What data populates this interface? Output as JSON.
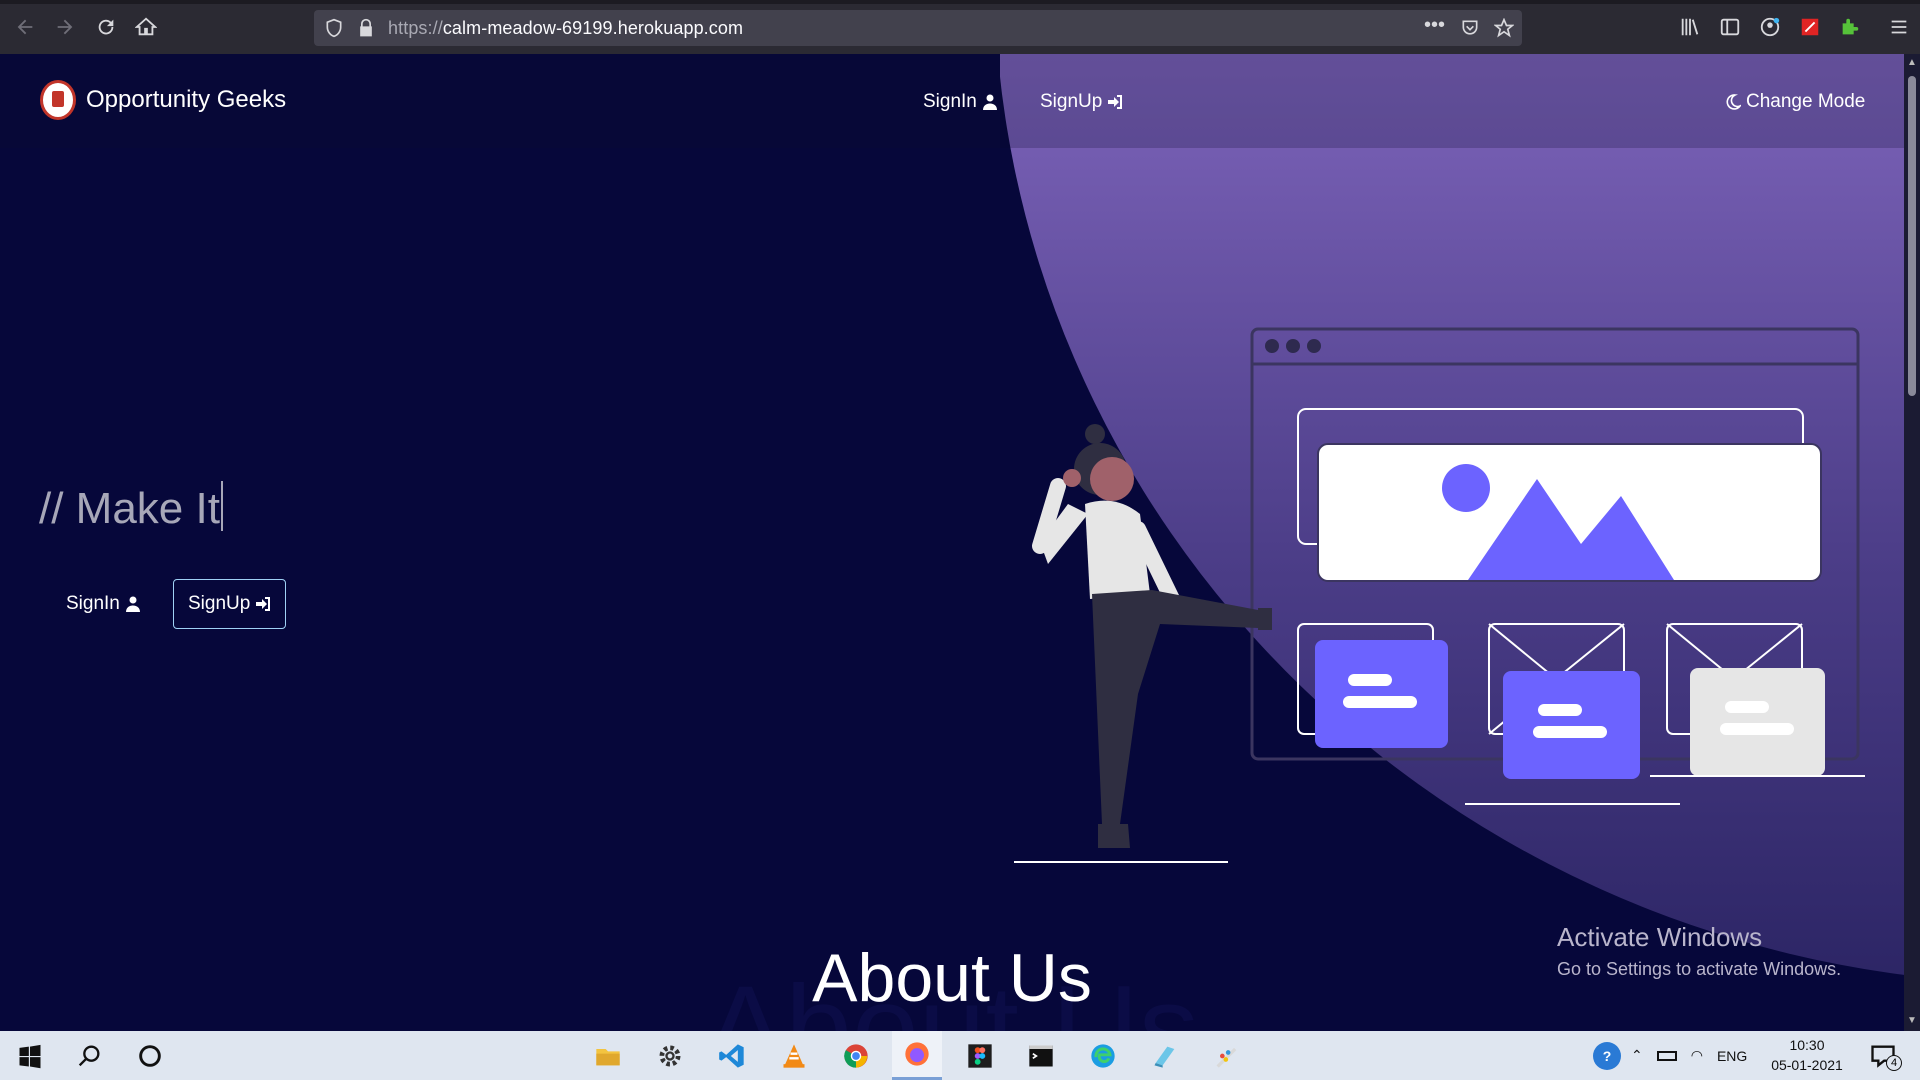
{
  "browser": {
    "url_scheme": "https://",
    "url_host": "calm-meadow-69199.herokuapp.com",
    "icons": [
      "back-icon",
      "forward-icon",
      "reload-icon",
      "home-icon",
      "shield-icon",
      "lock-icon",
      "more-icon",
      "pocket-icon",
      "star-icon",
      "library-icon",
      "sidebar-icon",
      "account-icon",
      "extension-red-icon",
      "puzzle-icon",
      "menu-icon"
    ]
  },
  "site": {
    "brand": "Opportunity Geeks",
    "nav": {
      "signin": "SignIn",
      "signup": "SignUp",
      "change_mode": "Change Mode"
    },
    "hero": {
      "typed_text": "// Make It",
      "signin_button": "SignIn",
      "signup_button": "SignUp"
    },
    "section_title": "About Us",
    "section_title_shadow": "About Us"
  },
  "watermark": {
    "title": "Activate Windows",
    "subtitle": "Go to Settings to activate Windows."
  },
  "taskbar": {
    "apps": [
      "windows-start-icon",
      "search-icon",
      "cortana-icon",
      "file-explorer-icon",
      "settings-icon",
      "vscode-icon",
      "vlc-icon",
      "chrome-icon",
      "firefox-icon",
      "figma-icon",
      "terminal-icon",
      "edge-icon",
      "app-icon",
      "paint-icon"
    ],
    "language": "ENG",
    "time": "10:30",
    "date": "05-01-2021",
    "notifications": "4"
  },
  "colors": {
    "page_bg": "#06073a",
    "accent_purple": "#6c63ff",
    "blob_top": "#a58ce0"
  }
}
